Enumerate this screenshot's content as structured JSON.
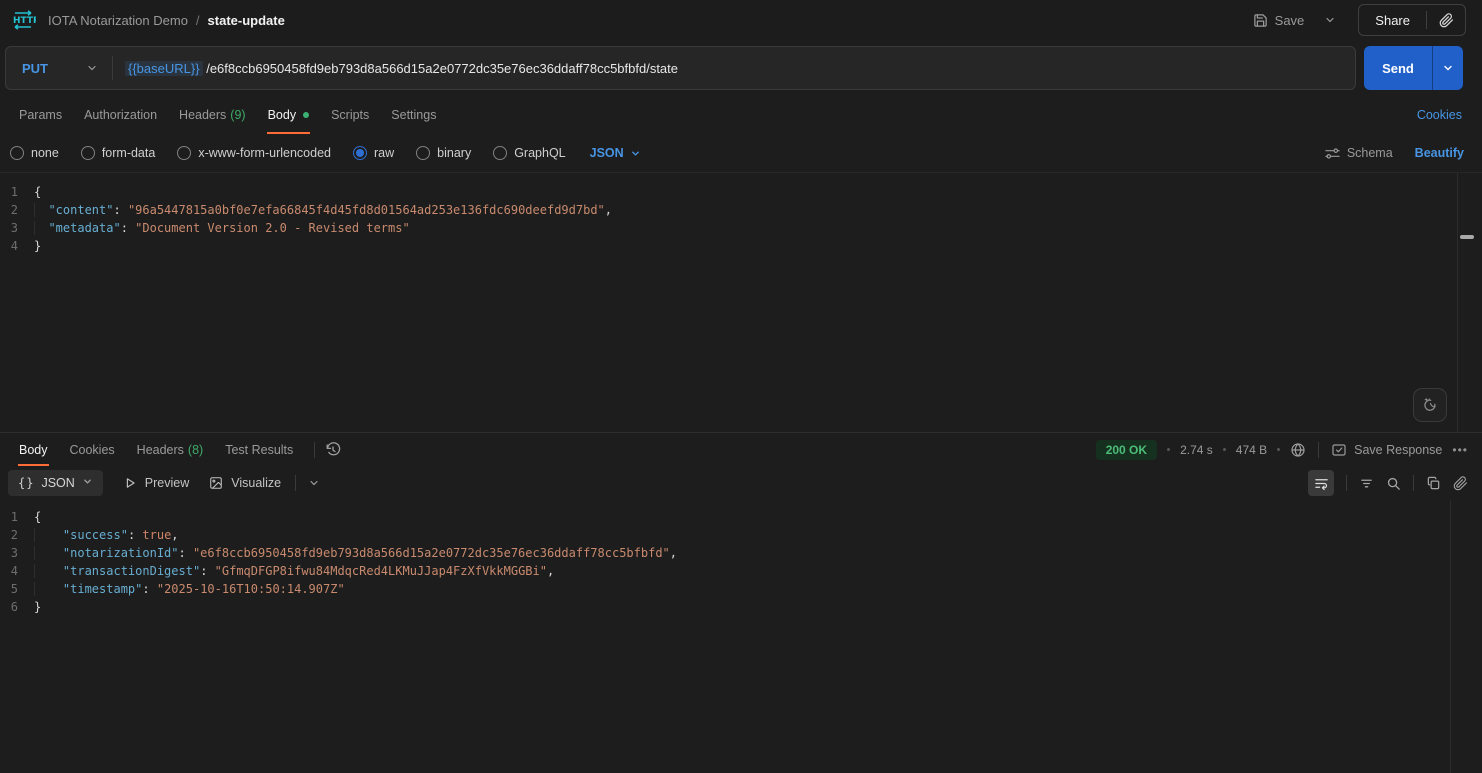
{
  "topbar": {
    "workspace": "IOTA Notarization Demo",
    "separator": "/",
    "request_name": "state-update",
    "save_label": "Save",
    "share_label": "Share"
  },
  "request": {
    "method": "PUT",
    "url_variable": "{{baseURL}}",
    "url_path": "/e6f8ccb6950458fd9eb793d8a566d15a2e0772dc35e76ec36ddaff78cc5bfbfd/state",
    "send_label": "Send"
  },
  "request_tabs": [
    {
      "label": "Params"
    },
    {
      "label": "Authorization"
    },
    {
      "label": "Headers",
      "count": "(9)"
    },
    {
      "label": "Body"
    },
    {
      "label": "Scripts"
    },
    {
      "label": "Settings"
    }
  ],
  "cookies_label": "Cookies",
  "body_options": {
    "radios": [
      "none",
      "form-data",
      "x-www-form-urlencoded",
      "raw",
      "binary",
      "GraphQL"
    ],
    "selected": "raw",
    "format": "JSON",
    "schema_label": "Schema",
    "beautify_label": "Beautify"
  },
  "request_body": {
    "lines": [
      {
        "n": "1",
        "t": [
          {
            "c": "p",
            "v": "{"
          }
        ]
      },
      {
        "n": "2",
        "t": [
          {
            "c": "w",
            "v": "  "
          },
          {
            "c": "k",
            "v": "\"content\""
          },
          {
            "c": "p",
            "v": ": "
          },
          {
            "c": "s",
            "v": "\"96a5447815a0bf0e7efa66845f4d45fd8d01564ad253e136fdc690deefd9d7bd\""
          },
          {
            "c": "p",
            "v": ","
          }
        ]
      },
      {
        "n": "3",
        "t": [
          {
            "c": "w",
            "v": "  "
          },
          {
            "c": "k",
            "v": "\"metadata\""
          },
          {
            "c": "p",
            "v": ": "
          },
          {
            "c": "s",
            "v": "\"Document Version 2.0 - Revised terms\""
          }
        ]
      },
      {
        "n": "4",
        "t": [
          {
            "c": "p",
            "v": "}"
          }
        ]
      }
    ]
  },
  "response": {
    "tabs": [
      {
        "label": "Body"
      },
      {
        "label": "Cookies"
      },
      {
        "label": "Headers",
        "count": "(8)"
      },
      {
        "label": "Test Results"
      }
    ],
    "status": "200 OK",
    "time": "2.74 s",
    "size": "474 B",
    "save_label": "Save Response",
    "more_label": "•••",
    "format": "JSON",
    "braces_icon": "{}",
    "preview_label": "Preview",
    "visualize_label": "Visualize"
  },
  "response_body": {
    "lines": [
      {
        "n": "1",
        "t": [
          {
            "c": "p",
            "v": "{"
          }
        ]
      },
      {
        "n": "2",
        "t": [
          {
            "c": "w",
            "v": "    "
          },
          {
            "c": "k",
            "v": "\"success\""
          },
          {
            "c": "p",
            "v": ": "
          },
          {
            "c": "b",
            "v": "true"
          },
          {
            "c": "p",
            "v": ","
          }
        ]
      },
      {
        "n": "3",
        "t": [
          {
            "c": "w",
            "v": "    "
          },
          {
            "c": "k",
            "v": "\"notarizationId\""
          },
          {
            "c": "p",
            "v": ": "
          },
          {
            "c": "s",
            "v": "\"e6f8ccb6950458fd9eb793d8a566d15a2e0772dc35e76ec36ddaff78cc5bfbfd\""
          },
          {
            "c": "p",
            "v": ","
          }
        ]
      },
      {
        "n": "4",
        "t": [
          {
            "c": "w",
            "v": "    "
          },
          {
            "c": "k",
            "v": "\"transactionDigest\""
          },
          {
            "c": "p",
            "v": ": "
          },
          {
            "c": "s",
            "v": "\"GfmqDFGP8ifwu84MdqcRed4LKMuJJap4FzXfVkkMGGBi\""
          },
          {
            "c": "p",
            "v": ","
          }
        ]
      },
      {
        "n": "5",
        "t": [
          {
            "c": "w",
            "v": "    "
          },
          {
            "c": "k",
            "v": "\"timestamp\""
          },
          {
            "c": "p",
            "v": ": "
          },
          {
            "c": "s",
            "v": "\"2025-10-16T10:50:14.907Z\""
          }
        ]
      },
      {
        "n": "6",
        "t": [
          {
            "c": "p",
            "v": "}"
          }
        ]
      }
    ]
  },
  "colors": {
    "accent_orange": "#ff6c37",
    "link_blue": "#4795e4",
    "send_blue": "#2160c9",
    "success_green": "#3eab67",
    "status_badge_bg": "#16301f",
    "status_badge_text": "#4cbd78",
    "json_key": "#68aed2",
    "json_string": "#c98a6e",
    "json_bool": "#cf8568",
    "http_icon_teal": "#25c2d1"
  }
}
